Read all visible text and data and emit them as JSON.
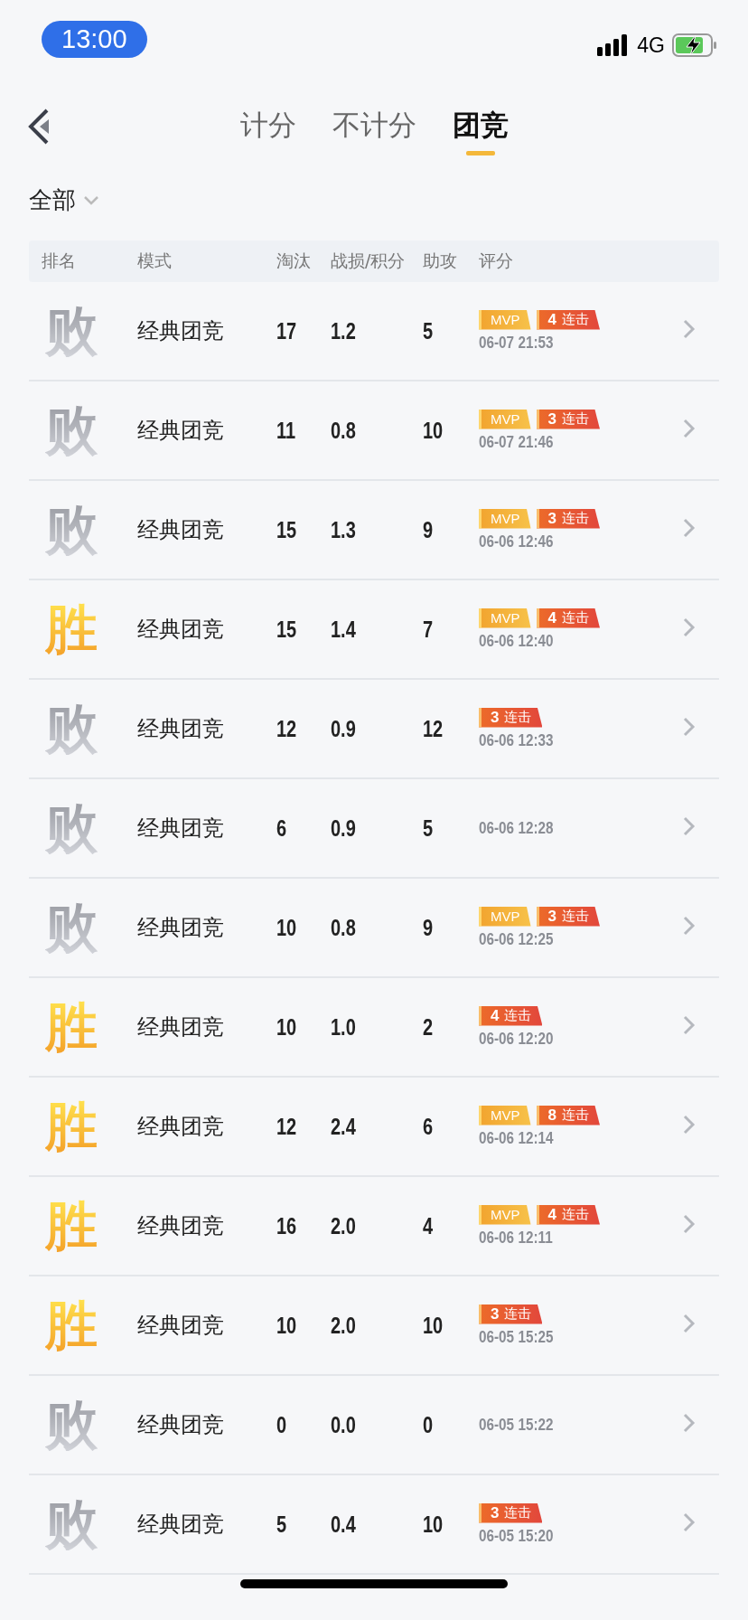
{
  "status_bar": {
    "time": "13:00",
    "network": "4G"
  },
  "tabs": [
    {
      "label": "计分",
      "selected": false
    },
    {
      "label": "不计分",
      "selected": false
    },
    {
      "label": "团竞",
      "selected": true
    }
  ],
  "filter": {
    "label": "全部"
  },
  "table": {
    "columns": [
      "排名",
      "模式",
      "淘汰",
      "战损/积分",
      "助攻",
      "评分"
    ],
    "rows": [
      {
        "kind": "loss",
        "result": "败",
        "mode": "经典团竞",
        "kills": "17",
        "ratio": "1.2",
        "assists": "5",
        "badges": [
          {
            "kind": "mvp",
            "label": "MVP"
          },
          {
            "kind": "streak",
            "count": "4",
            "label": "连击"
          }
        ],
        "time": "06-07 21:53"
      },
      {
        "kind": "loss",
        "result": "败",
        "mode": "经典团竞",
        "kills": "11",
        "ratio": "0.8",
        "assists": "10",
        "badges": [
          {
            "kind": "mvp",
            "label": "MVP"
          },
          {
            "kind": "streak",
            "count": "3",
            "label": "连击"
          }
        ],
        "time": "06-07 21:46"
      },
      {
        "kind": "loss",
        "result": "败",
        "mode": "经典团竞",
        "kills": "15",
        "ratio": "1.3",
        "assists": "9",
        "badges": [
          {
            "kind": "mvp",
            "label": "MVP"
          },
          {
            "kind": "streak",
            "count": "3",
            "label": "连击"
          }
        ],
        "time": "06-06 12:46"
      },
      {
        "kind": "win",
        "result": "胜",
        "mode": "经典团竞",
        "kills": "15",
        "ratio": "1.4",
        "assists": "7",
        "badges": [
          {
            "kind": "mvp",
            "label": "MVP"
          },
          {
            "kind": "streak",
            "count": "4",
            "label": "连击"
          }
        ],
        "time": "06-06 12:40"
      },
      {
        "kind": "loss",
        "result": "败",
        "mode": "经典团竞",
        "kills": "12",
        "ratio": "0.9",
        "assists": "12",
        "badges": [
          {
            "kind": "streak",
            "count": "3",
            "label": "连击"
          }
        ],
        "time": "06-06 12:33"
      },
      {
        "kind": "loss",
        "result": "败",
        "mode": "经典团竞",
        "kills": "6",
        "ratio": "0.9",
        "assists": "5",
        "time": "06-06 12:28"
      },
      {
        "kind": "loss",
        "result": "败",
        "mode": "经典团竞",
        "kills": "10",
        "ratio": "0.8",
        "assists": "9",
        "badges": [
          {
            "kind": "mvp",
            "label": "MVP"
          },
          {
            "kind": "streak",
            "count": "3",
            "label": "连击"
          }
        ],
        "time": "06-06 12:25"
      },
      {
        "kind": "win",
        "result": "胜",
        "mode": "经典团竞",
        "kills": "10",
        "ratio": "1.0",
        "assists": "2",
        "badges": [
          {
            "kind": "streak",
            "count": "4",
            "label": "连击"
          }
        ],
        "time": "06-06 12:20"
      },
      {
        "kind": "win",
        "result": "胜",
        "mode": "经典团竞",
        "kills": "12",
        "ratio": "2.4",
        "assists": "6",
        "badges": [
          {
            "kind": "mvp",
            "label": "MVP"
          },
          {
            "kind": "streak",
            "count": "8",
            "label": "连击"
          }
        ],
        "time": "06-06 12:14"
      },
      {
        "kind": "win",
        "result": "胜",
        "mode": "经典团竞",
        "kills": "16",
        "ratio": "2.0",
        "assists": "4",
        "badges": [
          {
            "kind": "mvp",
            "label": "MVP"
          },
          {
            "kind": "streak",
            "count": "4",
            "label": "连击"
          }
        ],
        "time": "06-06 12:11"
      },
      {
        "kind": "win",
        "result": "胜",
        "mode": "经典团竞",
        "kills": "10",
        "ratio": "2.0",
        "assists": "10",
        "badges": [
          {
            "kind": "streak",
            "count": "3",
            "label": "连击"
          }
        ],
        "time": "06-05 15:25"
      },
      {
        "kind": "loss",
        "result": "败",
        "mode": "经典团竞",
        "kills": "0",
        "ratio": "0.0",
        "assists": "0",
        "time": "06-05 15:22"
      },
      {
        "kind": "loss",
        "result": "败",
        "mode": "经典团竞",
        "kills": "5",
        "ratio": "0.4",
        "assists": "10",
        "badges": [
          {
            "kind": "streak",
            "count": "3",
            "label": "连击"
          }
        ],
        "time": "06-05 15:20"
      }
    ]
  }
}
